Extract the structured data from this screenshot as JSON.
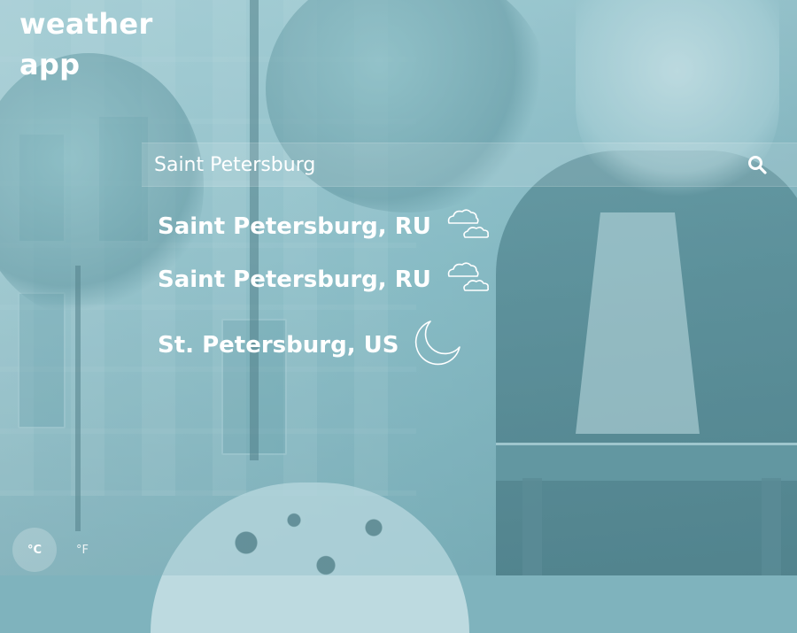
{
  "app": {
    "title_line1": "weather",
    "title_line2": "app"
  },
  "search": {
    "value": "Saint Petersburg",
    "placeholder": "",
    "icon": "search-icon"
  },
  "results": [
    {
      "name": "Saint Petersburg, RU",
      "icon": "cloudy-icon"
    },
    {
      "name": "Saint Petersburg, RU",
      "icon": "cloudy-icon"
    },
    {
      "name": "St. Petersburg, US",
      "icon": "moon-icon"
    }
  ],
  "units": {
    "celsius": "°C",
    "fahrenheit": "°F",
    "active": "celsius"
  },
  "colors": {
    "text": "#ffffff",
    "tint": "#7fb3bd"
  }
}
